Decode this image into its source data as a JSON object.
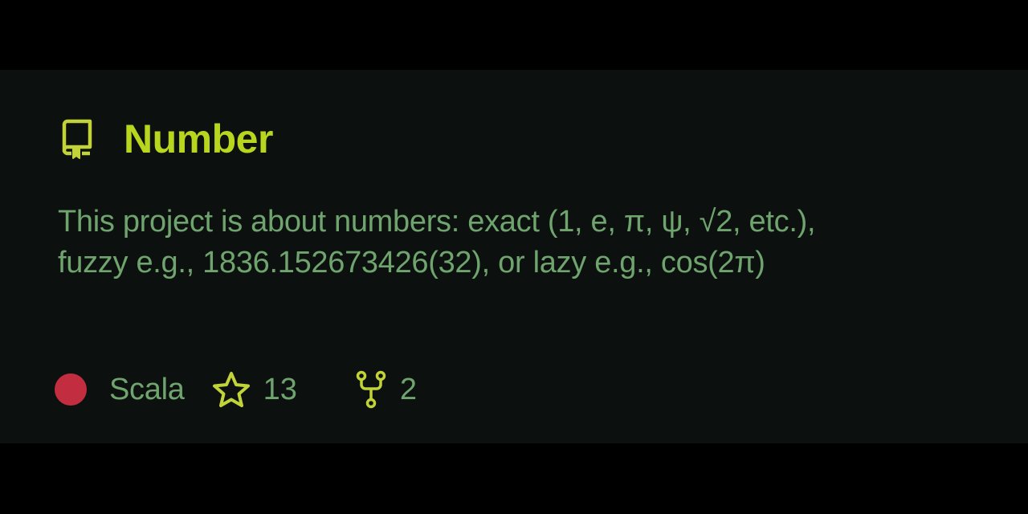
{
  "repo": {
    "title": "Number",
    "icon": "repo-icon",
    "description": "This project is about numbers: exact (1, e, π, ψ, √2, etc.), fuzzy e.g., 1836.152673426(32), or lazy e.g., cos(2π)",
    "language": {
      "name": "Scala",
      "color": "#c22d40"
    },
    "stars": {
      "icon": "star-icon",
      "count": "13"
    },
    "forks": {
      "icon": "fork-icon",
      "count": "2"
    }
  },
  "colors": {
    "background": "#000000",
    "card": "#0c100e",
    "title": "#b8d61e",
    "text": "#6fa46e",
    "icon": "#c2d33a"
  }
}
